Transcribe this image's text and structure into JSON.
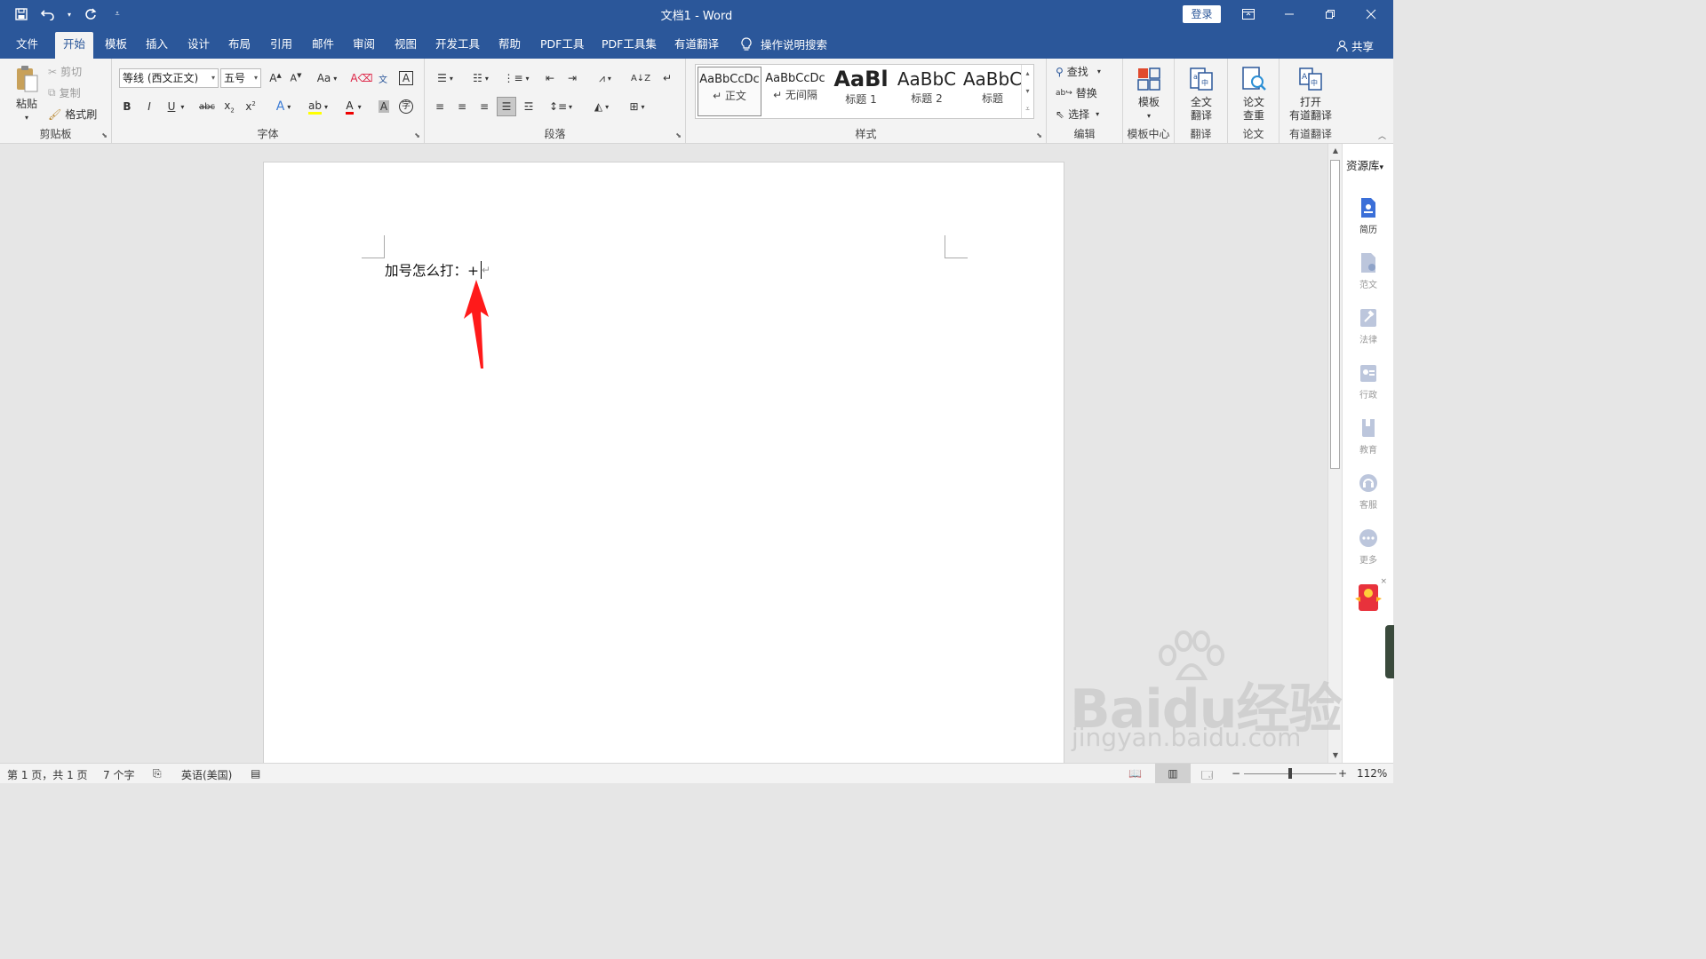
{
  "window": {
    "title": "文档1  -  Word",
    "login_label": "登录"
  },
  "tabs": {
    "items": [
      "文件",
      "开始",
      "模板",
      "插入",
      "设计",
      "布局",
      "引用",
      "邮件",
      "审阅",
      "视图",
      "开发工具",
      "帮助",
      "PDF工具",
      "PDF工具集",
      "有道翻译"
    ],
    "active": "开始",
    "search_label": "操作说明搜索",
    "share_label": "共享"
  },
  "ribbon": {
    "clipboard": {
      "label": "剪贴板",
      "paste": "粘贴",
      "cut": "剪切",
      "copy": "复制",
      "format_painter": "格式刷"
    },
    "font": {
      "label": "字体",
      "font_name": "等线 (西文正文)",
      "font_size": "五号",
      "change_case": "Aa"
    },
    "paragraph": {
      "label": "段落"
    },
    "styles": {
      "label": "样式",
      "items": [
        {
          "preview": "AaBbCcDc",
          "name": "↵ 正文"
        },
        {
          "preview": "AaBbCcDc",
          "name": "↵ 无间隔"
        },
        {
          "preview": "AaBl",
          "name": "标题 1"
        },
        {
          "preview": "AaBbC",
          "name": "标题 2"
        },
        {
          "preview": "AaBbC",
          "name": "标题"
        }
      ]
    },
    "editing": {
      "label": "编辑",
      "find": "查找",
      "replace": "替换",
      "select": "选择"
    },
    "template_center": {
      "label": "模板中心",
      "button": "模板"
    },
    "translate": {
      "label": "翻译",
      "button_line1": "全文",
      "button_line2": "翻译"
    },
    "paper": {
      "label": "论文",
      "button_line1": "论文",
      "button_line2": "查重"
    },
    "youdao": {
      "label": "有道翻译",
      "button_line1": "打开",
      "button_line2": "有道翻译"
    }
  },
  "document": {
    "text": "加号怎么打：+",
    "paragraph_mark": "↵"
  },
  "side_panel": {
    "header": "资源库",
    "items": [
      "简历",
      "范文",
      "法律",
      "行政",
      "教育",
      "客服",
      "更多"
    ]
  },
  "watermark": {
    "line1": "Baidu经验",
    "line2": "jingyan.baidu.com"
  },
  "status": {
    "page": "第 1 页，共 1 页",
    "words": "7 个字",
    "language": "英语(美国)",
    "zoom": "112%"
  },
  "colors": {
    "brand": "#2b579a",
    "arrow": "#ff1a1a"
  }
}
